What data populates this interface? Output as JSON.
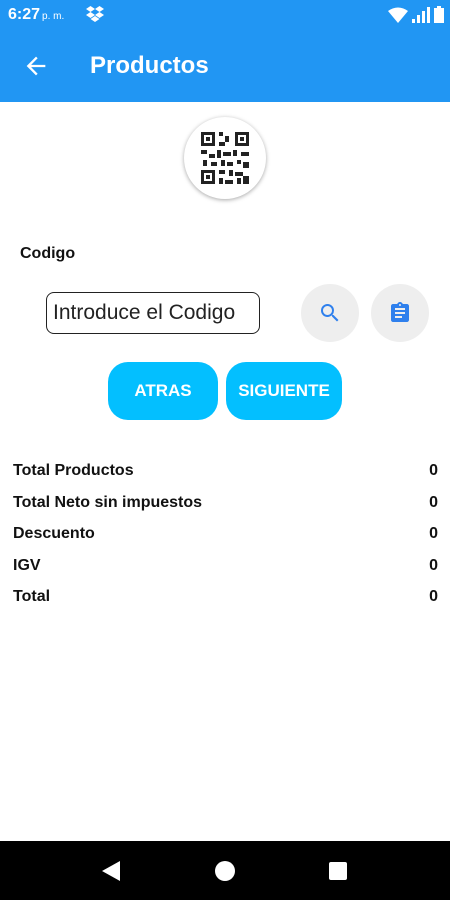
{
  "status_bar": {
    "time": "6:27",
    "ampm": "p. m.",
    "icons": [
      "dropbox-icon",
      "wifi-icon",
      "signal-icon",
      "battery-icon"
    ]
  },
  "app_bar": {
    "title": "Productos",
    "back_icon": "arrow-back-icon"
  },
  "qr_icon": "qr-code-icon",
  "code": {
    "label": "Codigo",
    "placeholder": "Introduce el Codigo",
    "value": ""
  },
  "actions": {
    "search_icon": "search-icon",
    "clipboard_icon": "clipboard-icon",
    "back_label": "ATRAS",
    "next_label": "SIGUIENTE"
  },
  "summary": [
    {
      "label": "Total Productos",
      "value": "0"
    },
    {
      "label": "Total Neto sin impuestos",
      "value": "0"
    },
    {
      "label": "Descuento",
      "value": "0"
    },
    {
      "label": "IGV",
      "value": "0"
    },
    {
      "label": "Total",
      "value": "0"
    }
  ],
  "colors": {
    "primary": "#2196F3",
    "accent_button": "#03BFFF",
    "icon_blue": "#2F80ED"
  },
  "nav_icons": [
    "nav-back-icon",
    "nav-home-icon",
    "nav-recents-icon"
  ]
}
